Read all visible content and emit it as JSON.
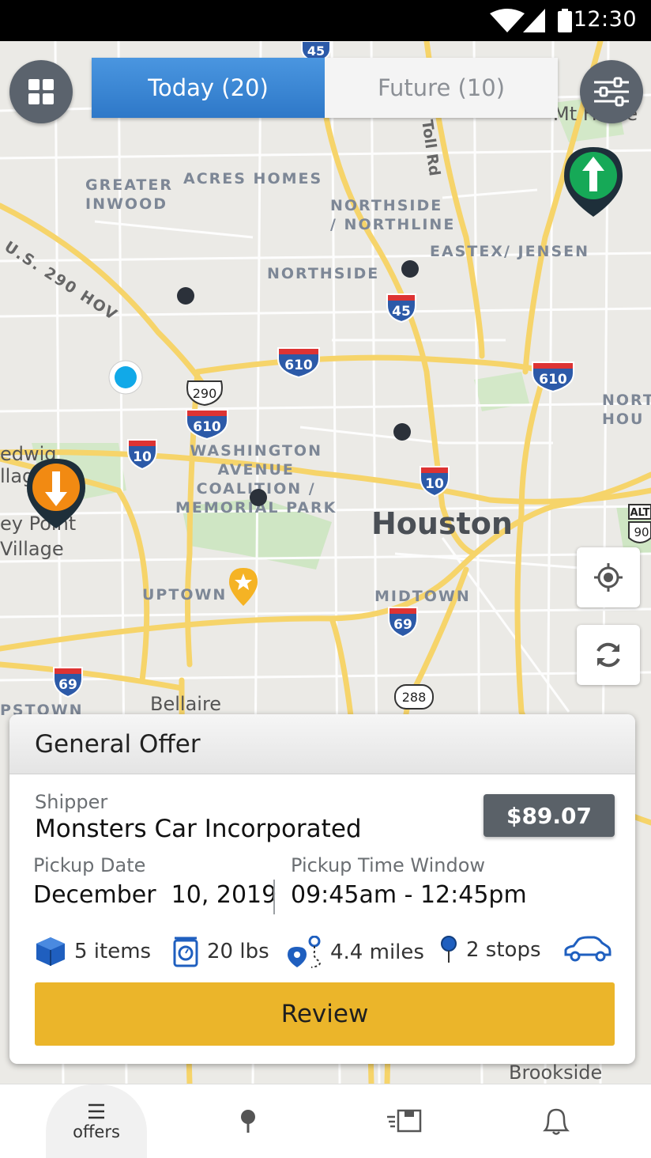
{
  "status_bar": {
    "time": "12:30"
  },
  "tabs": {
    "today": "Today (20)",
    "future": "Future (10)"
  },
  "map": {
    "labels": {
      "greater_inwood": "GREATER\nINWOOD",
      "acres_homes": "ACRES HOMES",
      "northside_northline": "NORTHSIDE\n/ NORTHLINE",
      "eastex_jensen": "EASTEX/ JENSEN",
      "northside": "NORTHSIDE",
      "washington": "WASHINGTON\nAVENUE\nCOALITION /\nMEMORIAL PARK",
      "houston": "Houston",
      "uptown": "UPTOWN",
      "midtown": "MIDTOWN",
      "bellaire": "Bellaire",
      "brookside": "Brookside",
      "hedwig": "edwig\nllag",
      "piney_point": "ey Point\nVillage",
      "mt_houston": "Mt Hoste",
      "north_hou": "NORT\nHOU",
      "pstown": "PSTOWN",
      "us290hov": "U.S. 290 HOV",
      "toll_rd": "Toll Rd"
    },
    "shields": {
      "i45_top": "45",
      "i45": "45",
      "i610_n": "610",
      "i610_ne": "610",
      "us290": "290",
      "i610_w": "610",
      "i10_w": "10",
      "i10_e": "10",
      "i69": "69",
      "i69_sw": "69",
      "tx288": "288",
      "alt90": "ALT\n90"
    }
  },
  "offer_card": {
    "title": "General Offer",
    "shipper_label": "Shipper",
    "shipper_name": "Monsters Car Incorporated",
    "price": "$89.07",
    "pickup_date_label": "Pickup Date",
    "pickup_date": "December  10, 2019",
    "pickup_window_label": "Pickup Time Window",
    "pickup_window": "09:45am - 12:45pm",
    "items": "5 items",
    "weight": "20 lbs",
    "distance": "4.4 miles",
    "stops": "2 stops",
    "review_label": "Review"
  },
  "bottom_nav": {
    "offers_label": "offers"
  },
  "colors": {
    "accent_blue": "#3585d3",
    "review_yellow": "#ebb52a",
    "pickup_green": "#16a957",
    "drop_orange": "#f28a12",
    "dark_button": "#5b636d"
  },
  "icons": [
    "grid-icon",
    "filter-icon",
    "locate-icon",
    "refresh-icon",
    "box-icon",
    "scale-icon",
    "route-icon",
    "stop-pin-icon",
    "car-icon",
    "list-icon",
    "pin-icon",
    "package-icon",
    "bell-icon"
  ]
}
